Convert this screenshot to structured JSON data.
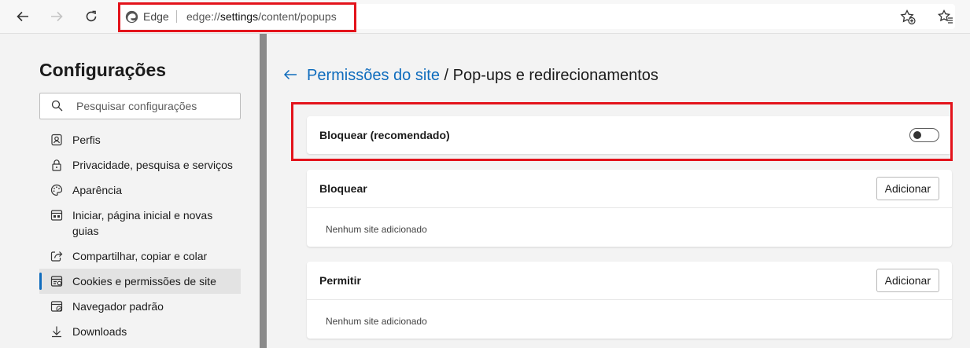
{
  "browser": {
    "address_brand": "Edge",
    "url_prefix": "edge://",
    "url_host": "settings",
    "url_path": "/content/popups"
  },
  "sidebar": {
    "title": "Configurações",
    "search_placeholder": "Pesquisar configurações",
    "items": [
      {
        "label": "Perfis",
        "icon": "profile-icon"
      },
      {
        "label": "Privacidade, pesquisa e serviços",
        "icon": "lock-icon"
      },
      {
        "label": "Aparência",
        "icon": "palette-icon"
      },
      {
        "label": "Iniciar, página inicial e novas guias",
        "icon": "home-tabs-icon"
      },
      {
        "label": "Compartilhar, copiar e colar",
        "icon": "share-icon"
      },
      {
        "label": "Cookies e permissões de site",
        "icon": "cookies-icon",
        "active": true
      },
      {
        "label": "Navegador padrão",
        "icon": "browser-icon"
      },
      {
        "label": "Downloads",
        "icon": "download-icon"
      }
    ]
  },
  "main": {
    "breadcrumb_link": "Permissões do site",
    "breadcrumb_rest": " / Pop-ups e redirecionamentos",
    "block_toggle": {
      "label": "Bloquear (recomendado)",
      "on": false
    },
    "block_section": {
      "title": "Bloquear",
      "button": "Adicionar",
      "empty": "Nenhum site adicionado"
    },
    "allow_section": {
      "title": "Permitir",
      "button": "Adicionar",
      "empty": "Nenhum site adicionado"
    }
  },
  "colors": {
    "accent": "#0f6cbd",
    "highlight": "#e3131b"
  }
}
